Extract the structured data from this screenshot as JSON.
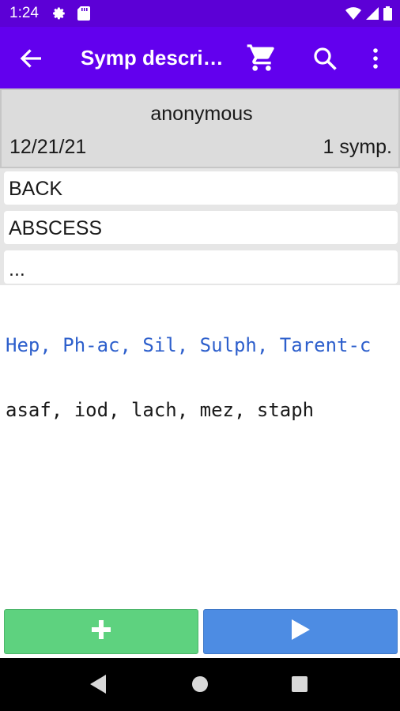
{
  "status_bar": {
    "time": "1:24",
    "icons": [
      "gear-icon",
      "sd-card-icon",
      "wifi-icon",
      "signal-icon",
      "battery-icon"
    ]
  },
  "app_bar": {
    "title": "Symp description",
    "icons": [
      "back-arrow-icon",
      "cart-icon",
      "search-icon",
      "overflow-menu-icon"
    ]
  },
  "header": {
    "name": "anonymous",
    "date": "12/21/21",
    "count": "1 symp."
  },
  "symptoms": [
    {
      "label": "BACK"
    },
    {
      "label": "ABSCESS"
    },
    {
      "label": "..."
    }
  ],
  "remedies": {
    "primary": "Hep, Ph-ac, Sil, Sulph, Tarent-c",
    "secondary": "asaf, iod, lach, mez, staph"
  },
  "actions": {
    "add_icon": "plus-icon",
    "play_icon": "play-icon"
  },
  "colors": {
    "status_bar": "#5c00d6",
    "app_bar": "#6200ee",
    "add_button": "#5ed27f",
    "play_button": "#4d8ce3",
    "primary_remedy_text": "#2d5fcc"
  },
  "nav_bar": {
    "icons": [
      "nav-back-icon",
      "nav-home-icon",
      "nav-recents-icon"
    ]
  }
}
